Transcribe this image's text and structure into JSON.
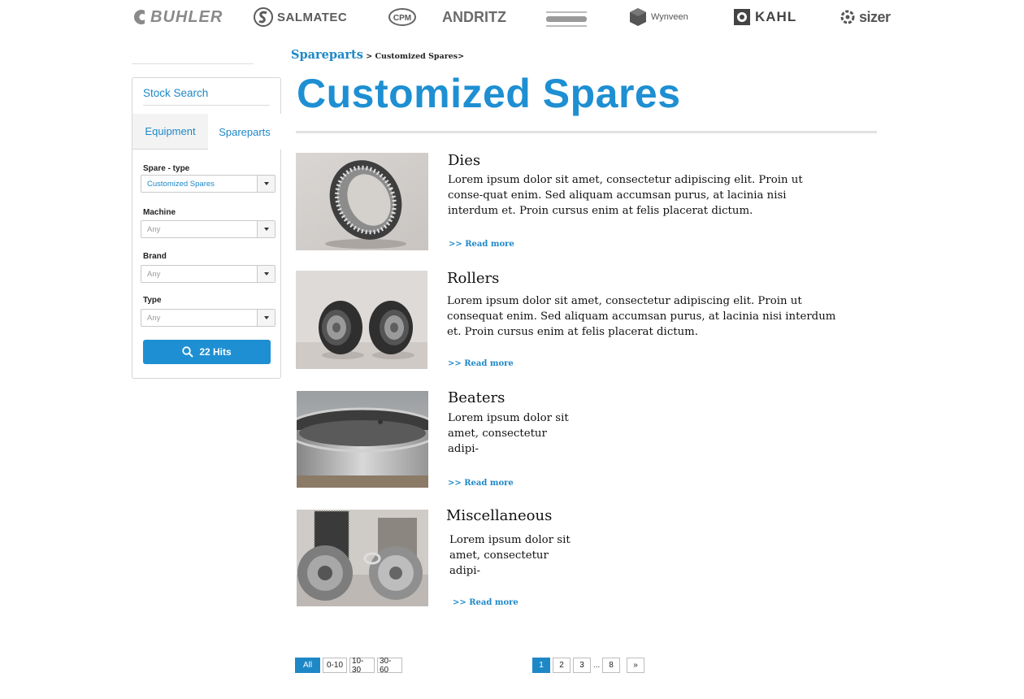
{
  "brands": [
    {
      "key": "buhler",
      "name": "BUHLER"
    },
    {
      "key": "salmatec",
      "name": "SALMATEC"
    },
    {
      "key": "cpm",
      "name": "CPM"
    },
    {
      "key": "andritz",
      "name": "ANDRITZ"
    },
    {
      "key": "wynveen",
      "name": "Wynveen"
    },
    {
      "key": "kahl",
      "name": "KAHL"
    },
    {
      "key": "sizer",
      "name": "sizer"
    }
  ],
  "sidebar": {
    "title": "Stock Search",
    "tabs": [
      "Equipment",
      "Spareparts"
    ],
    "fields": [
      {
        "label": "Spare - type",
        "value": "Customized Spares"
      },
      {
        "label": "Machine",
        "value": "Any"
      },
      {
        "label": "Brand",
        "value": "Any"
      },
      {
        "label": "Type",
        "value": "Any"
      }
    ],
    "hits_button": "22 Hits"
  },
  "breadcrumb": {
    "link": "Spareparts",
    "rest": " > Customized Spares>"
  },
  "page_title": "Customized Spares",
  "items": [
    {
      "title": "Dies",
      "desc": "Lorem ipsum dolor sit amet, consectetur adipiscing elit. Proin ut conse-quat enim. Sed aliquam accumsan purus, at lacinia nisi interdum et. Proin cursus enim at felis placerat dictum.",
      "read_more": ">> Read more"
    },
    {
      "title": "Rollers",
      "desc": "Lorem ipsum dolor sit amet, consectetur adipiscing elit. Proin ut consequat enim. Sed aliquam accumsan purus, at lacinia nisi interdum et. Proin cursus enim at felis placerat dictum.",
      "read_more": ">> Read more"
    },
    {
      "title": "Beaters",
      "desc": "Lorem ipsum dolor sit amet, consectetur adipi-",
      "read_more": ">> Read more"
    },
    {
      "title": "Miscellaneous",
      "desc": "Lorem ipsum dolor sit amet, consectetur adipi-",
      "read_more": ">> Read more"
    }
  ],
  "filters": [
    "All",
    "0-10",
    "10-30",
    "30-60"
  ],
  "pagination": {
    "pages": [
      "1",
      "2",
      "3"
    ],
    "ellipsis": "...",
    "last": "8",
    "next": "»",
    "current": "1"
  }
}
